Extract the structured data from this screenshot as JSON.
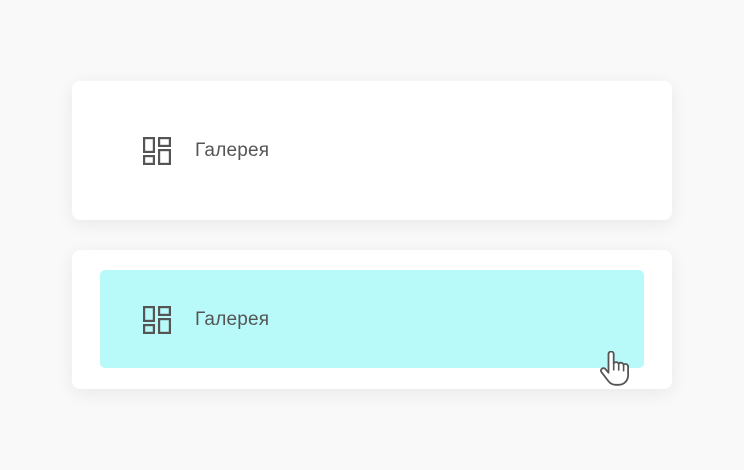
{
  "colors": {
    "page_background": "#f9f9f9",
    "card_background": "#ffffff",
    "hover_highlight": "#b8fafa",
    "icon": "#555555",
    "label_text": "#555555"
  },
  "cards": [
    {
      "state": "default",
      "item": {
        "icon": "dashboard-icon",
        "label": "Галерея"
      }
    },
    {
      "state": "hover",
      "item": {
        "icon": "dashboard-icon",
        "label": "Галерея"
      }
    }
  ],
  "cursor": {
    "icon": "hand-pointer-icon"
  }
}
